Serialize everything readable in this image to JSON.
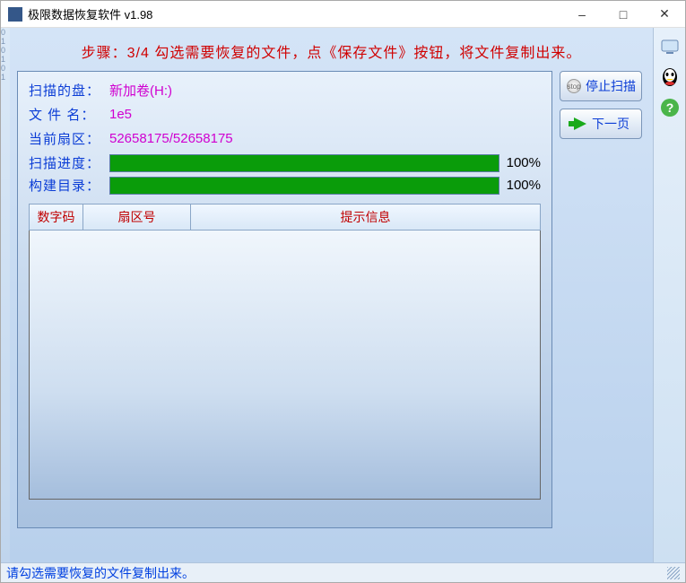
{
  "window": {
    "title": "极限数据恢复软件 v1.98"
  },
  "banner": "步骤：3/4 勾选需要恢复的文件，点《保存文件》按钮，将文件复制出来。",
  "info": {
    "disk_label": "扫描的盘：",
    "disk_value": "新加卷(H:)",
    "filename_label": "文 件 名：",
    "filename_value": "1e5",
    "sector_label": "当前扇区：",
    "sector_value": "52658175/52658175"
  },
  "progress": {
    "scan_label": "扫描进度：",
    "scan_pct": "100%",
    "build_label": "构建目录：",
    "build_pct": "100%"
  },
  "table": {
    "col_code": "数字码",
    "col_sector": "扇区号",
    "col_msg": "提示信息"
  },
  "buttons": {
    "stop": "停止扫描",
    "next": "下一页"
  },
  "status": "请勾选需要恢复的文件复制出来。"
}
